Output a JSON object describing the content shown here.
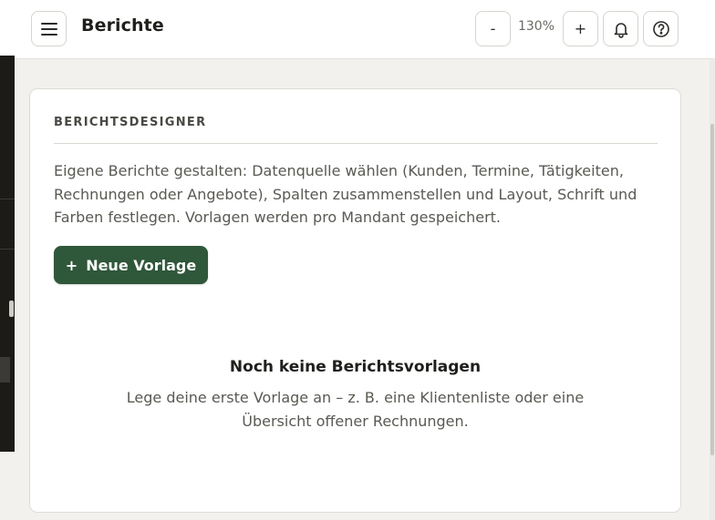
{
  "header": {
    "title": "Berichte",
    "zoom_out_label": "-",
    "zoom_level": "130%",
    "zoom_in_label": "+",
    "icons": [
      "menu-icon",
      "bell-icon",
      "help-icon"
    ]
  },
  "card": {
    "heading": "BERICHTSDESIGNER",
    "description": "Eigene Berichte gestalten: Datenquelle wählen (Kunden, Termine, Tätigkeiten, Rechnungen oder Angebote), Spalten zusammenstellen und Layout, Schrift und Farben festlegen. Vorlagen werden pro Mandant gespeichert.",
    "new_template_label": "Neue Vorlage",
    "new_template_icon": "+",
    "empty_title": "Noch keine Berichtsvorlagen",
    "empty_text": "Lege deine erste Vorlage an – z. B. eine Klientenliste oder eine Übersicht offener Rechnungen."
  },
  "colors": {
    "accent": "#2f573a",
    "background": "#f2f1ed",
    "sidebar": "#1c1b18"
  }
}
